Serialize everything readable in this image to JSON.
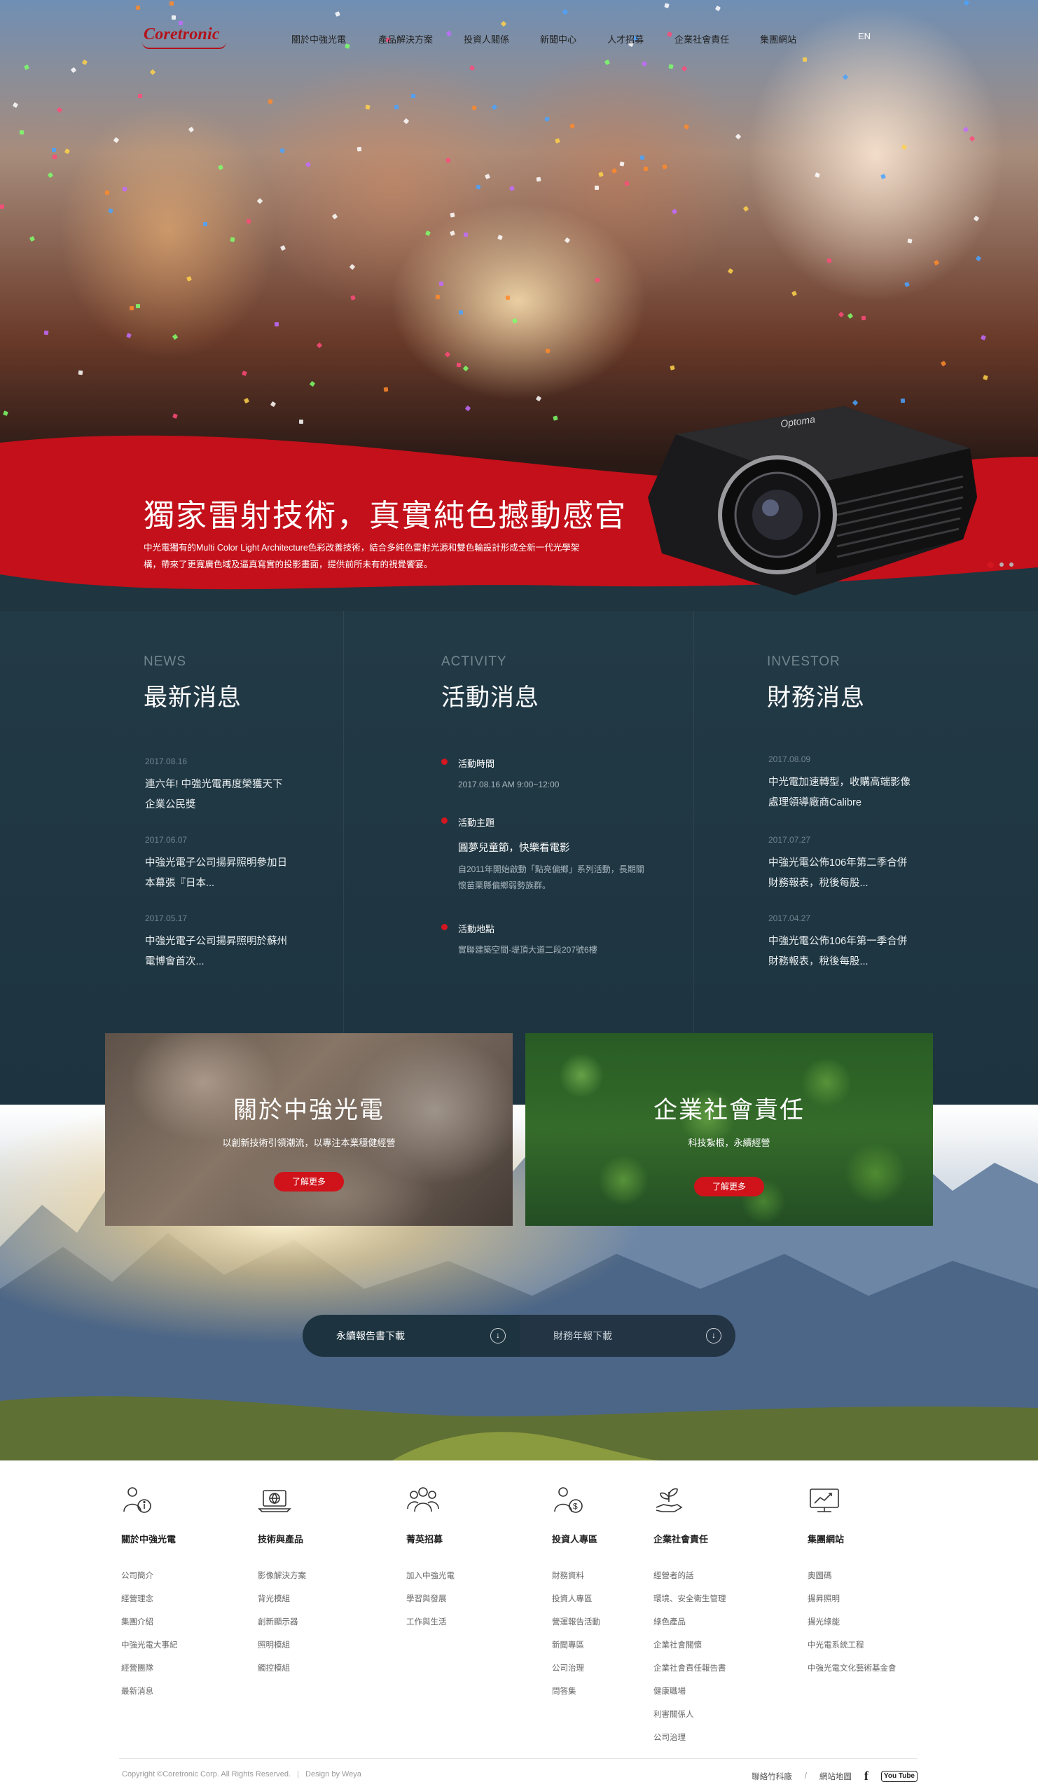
{
  "header": {
    "logo_text": "Coretronic",
    "nav": [
      "關於中強光電",
      "產品解決方案",
      "投資人關係",
      "新聞中心",
      "人才招募",
      "企業社會責任",
      "集團網站"
    ],
    "language": "EN"
  },
  "hero": {
    "title": "獨家雷射技術，真實純色撼動感官",
    "description": "中光電獨有的Multi Color Light Architecture色彩改善技術，結合多純色雷射光源和雙色輪設計形成全新一代光學架構，帶來了更寬廣色域及逼真寫實的投影畫面，提供前所未有的視覺饗宴。",
    "slide_count": 3,
    "active_slide": 1,
    "accent_color": "#c8101a"
  },
  "news": {
    "heading_en": "NEWS",
    "heading_zh": "最新消息",
    "items": [
      {
        "date": "2017.08.16",
        "title": "連六年! 中強光電再度榮獲天下企業公民獎"
      },
      {
        "date": "2017.06.07",
        "title": "中強光電子公司揚昇照明參加日本幕張『日本..."
      },
      {
        "date": "2017.05.17",
        "title": "中強光電子公司揚昇照明於蘇州電博會首次..."
      }
    ]
  },
  "activity": {
    "heading_en": "ACTIVITY",
    "heading_zh": "活動消息",
    "time_label": "活動時間",
    "time_value": "2017.08.16  AM  9:00~12:00",
    "topic_label": "活動主題",
    "topic_title": "圓夢兒童節，快樂看電影",
    "topic_desc": "自2011年開始啟動「點亮偏鄉」系列活動，長期關懷苗栗縣偏鄉弱勢族群。",
    "place_label": "活動地點",
    "place_value": "實聯建築空間-堤頂大道二段207號6樓"
  },
  "investor": {
    "heading_en": "INVESTOR",
    "heading_zh": "財務消息",
    "items": [
      {
        "date": "2017.08.09",
        "title": "中光電加速轉型，收購高端影像處理領導廠商Calibre"
      },
      {
        "date": "2017.07.27",
        "title": "中強光電公佈106年第二季合併財務報表，稅後每股..."
      },
      {
        "date": "2017.04.27",
        "title": "中強光電公佈106年第一季合併財務報表，稅後每股..."
      }
    ]
  },
  "promos": [
    {
      "title": "關於中強光電",
      "subtitle": "以創新技術引領潮流，以專注本業穩健經營",
      "button": "了解更多"
    },
    {
      "title": "企業社會責任",
      "subtitle": "科技紮根，永續經營",
      "button": "了解更多"
    }
  ],
  "downloads": {
    "sustain": "永續報告書下載",
    "annual": "財務年報下載"
  },
  "footer": {
    "columns": [
      {
        "icon": "person-info-icon",
        "title": "關於中強光電",
        "links": [
          "公司簡介",
          "經營理念",
          "集團介紹",
          "中強光電大事紀",
          "經營團隊",
          "最新消息"
        ]
      },
      {
        "icon": "laptop-globe-icon",
        "title": "技術與產品",
        "links": [
          "影像解決方案",
          "背光模組",
          "創新顯示器",
          "照明模組",
          "觸控模組"
        ]
      },
      {
        "icon": "team-icon",
        "title": "菁英招募",
        "links": [
          "加入中強光電",
          "學習與發展",
          "工作與生活"
        ]
      },
      {
        "icon": "investor-dollar-icon",
        "title": "投資人專區",
        "links": [
          "財務資料",
          "投資人專區",
          "營運報告活動",
          "新聞專區",
          "公司治理",
          "問答集"
        ]
      },
      {
        "icon": "hand-plant-icon",
        "title": "企業社會責任",
        "links": [
          "經營者的話",
          "環境、安全衛生管理",
          "綠色產品",
          "企業社會關懷",
          "企業社會責任報告書",
          "健康職場",
          "利害關係人",
          "公司治理"
        ]
      },
      {
        "icon": "monitor-chart-icon",
        "title": "集團網站",
        "links": [
          "奧圖碼",
          "揚昇照明",
          "揚光綠能",
          "中光電系統工程",
          "中強光電文化藝術基金會"
        ]
      }
    ],
    "copyright": "Copyright ©Coretronic Corp. All Rights Reserved.",
    "design_credit": "Design by Weya",
    "contact": "聯絡竹科廠",
    "separator": "/",
    "sitemap": "網站地圖",
    "facebook": "f",
    "youtube": "You Tube"
  }
}
